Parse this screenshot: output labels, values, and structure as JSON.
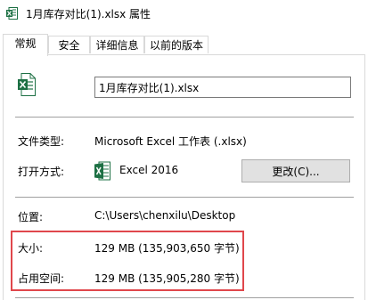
{
  "window": {
    "title": "1月库存对比(1).xlsx 属性"
  },
  "tabs": [
    {
      "label": "常规"
    },
    {
      "label": "安全"
    },
    {
      "label": "详细信息"
    },
    {
      "label": "以前的版本"
    }
  ],
  "general": {
    "filename": "1月库存对比(1).xlsx",
    "file_type_label": "文件类型:",
    "file_type_value": "Microsoft Excel 工作表 (.xlsx)",
    "opens_with_label": "打开方式:",
    "opens_with_app": "Excel 2016",
    "change_button": "更改(C)...",
    "location_label": "位置:",
    "location_value": "C:\\Users\\chenxilu\\Desktop",
    "size_label": "大小:",
    "size_value": "129 MB (135,903,650 字节)",
    "size_on_disk_label": "占用空间:",
    "size_on_disk_value": "129 MB (135,905,280 字节)"
  },
  "colors": {
    "excel_green": "#1d7044",
    "highlight_red": "#e0474c",
    "button_bg": "#e1e1e1"
  },
  "icons": {
    "title_icon": "excel-file-icon",
    "file_icon": "excel-file-icon",
    "app_icon": "excel-app-icon"
  }
}
